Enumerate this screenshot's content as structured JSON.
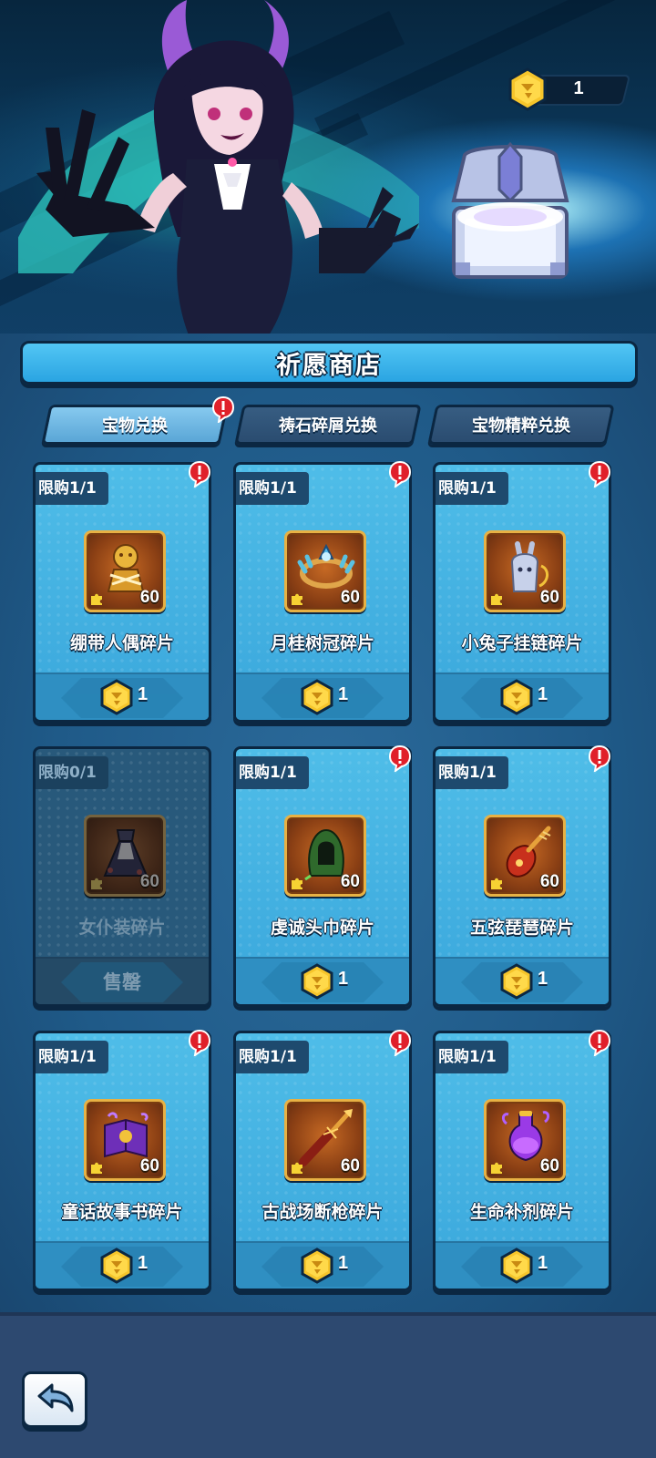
{
  "currency": {
    "icon": "wish-coin-icon",
    "amount": "1"
  },
  "shop": {
    "title": "祈愿商店",
    "tabs": [
      {
        "label": "宝物兑换",
        "active": true,
        "has_alert": true
      },
      {
        "label": "祷石碎屑兑换",
        "active": false,
        "has_alert": false
      },
      {
        "label": "宝物精粹兑换",
        "active": false,
        "has_alert": false
      }
    ],
    "items": [
      {
        "name": "绷带人偶碎片",
        "limit": "限购1/1",
        "quantity": "60",
        "price": "1",
        "sold_out": false,
        "icon": "bandage-doll-icon",
        "alert": true
      },
      {
        "name": "月桂树冠碎片",
        "limit": "限购1/1",
        "quantity": "60",
        "price": "1",
        "sold_out": false,
        "icon": "laurel-crown-icon",
        "alert": true
      },
      {
        "name": "小兔子挂链碎片",
        "limit": "限购1/1",
        "quantity": "60",
        "price": "1",
        "sold_out": false,
        "icon": "bunny-charm-icon",
        "alert": true
      },
      {
        "name": "女仆装碎片",
        "limit": "限购0/1",
        "quantity": "60",
        "price": "售罄",
        "sold_out": true,
        "icon": "maid-dress-icon",
        "alert": false
      },
      {
        "name": "虔诚头巾碎片",
        "limit": "限购1/1",
        "quantity": "60",
        "price": "1",
        "sold_out": false,
        "icon": "hood-icon",
        "alert": true
      },
      {
        "name": "五弦琵琶碎片",
        "limit": "限购1/1",
        "quantity": "60",
        "price": "1",
        "sold_out": false,
        "icon": "pipa-icon",
        "alert": true
      },
      {
        "name": "童话故事书碎片",
        "limit": "限购1/1",
        "quantity": "60",
        "price": "1",
        "sold_out": false,
        "icon": "storybook-icon",
        "alert": true
      },
      {
        "name": "古战场断枪碎片",
        "limit": "限购1/1",
        "quantity": "60",
        "price": "1",
        "sold_out": false,
        "icon": "broken-spear-icon",
        "alert": true
      },
      {
        "name": "生命补剂碎片",
        "limit": "限购1/1",
        "quantity": "60",
        "price": "1",
        "sold_out": false,
        "icon": "life-potion-icon",
        "alert": true
      }
    ]
  },
  "footer": {
    "back_icon": "back-arrow-icon"
  },
  "colors": {
    "card_blue": "#4fbde8",
    "outline": "#0b2742",
    "gold": "#f2c230",
    "alert_red": "#e0202a"
  }
}
